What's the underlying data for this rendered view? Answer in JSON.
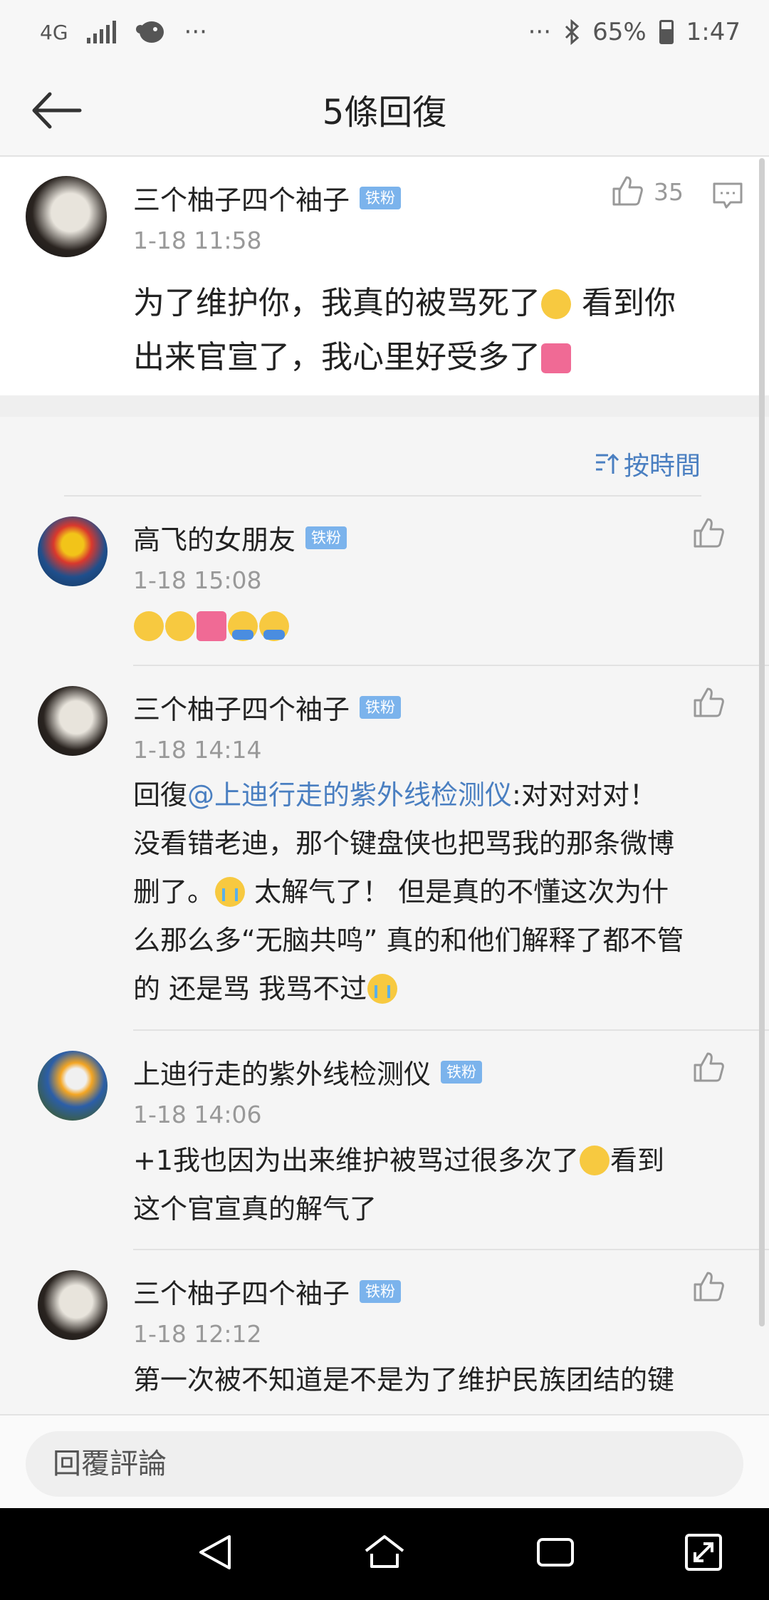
{
  "status_bar": {
    "network": "4G",
    "more_left": "···",
    "more_right": "···",
    "battery": "65%",
    "time": "1:47"
  },
  "header": {
    "title": "5條回復"
  },
  "main_comment": {
    "username": "三个柚子四个袖子",
    "badge": "铁粉",
    "time": "1-18 11:58",
    "text_line1": "为了维护你，我真的被骂死了",
    "text_line1b": " 看到你",
    "text_line2": "出来官宣了，我心里好受多了",
    "likes": "35"
  },
  "sort": {
    "label": "按時間"
  },
  "replies": [
    {
      "username": "高飞的女朋友",
      "badge": "铁粉",
      "time": "1-18 15:08"
    },
    {
      "username": "三个柚子四个袖子",
      "badge": "铁粉",
      "time": "1-18 14:14",
      "prefix": "回復",
      "mention": "@上迪行走的紫外线检测仪",
      "line1_rest": ":对对对对！",
      "line2": "没看错老迪，那个键盘侠也把骂我的那条微博",
      "line3a": "删了。",
      "line3b": " 太解气了！ 但是真的不懂这次为什",
      "line4": "么那么多“无脑共鸣” 真的和他们解释了都不管",
      "line5a": "的 还是骂 我骂不过"
    },
    {
      "username": "上迪行走的紫外线检测仪",
      "badge": "铁粉",
      "time": "1-18 14:06",
      "line1a": "+1我也因为出来维护被骂过很多次了",
      "line1b": "看到",
      "line2": "这个官宣真的解气了"
    },
    {
      "username": "三个柚子四个袖子",
      "badge": "铁粉",
      "time": "1-18 12:12",
      "line1": "第一次被不知道是不是为了维护民族团结的键"
    }
  ],
  "input": {
    "placeholder": "回覆評論"
  }
}
